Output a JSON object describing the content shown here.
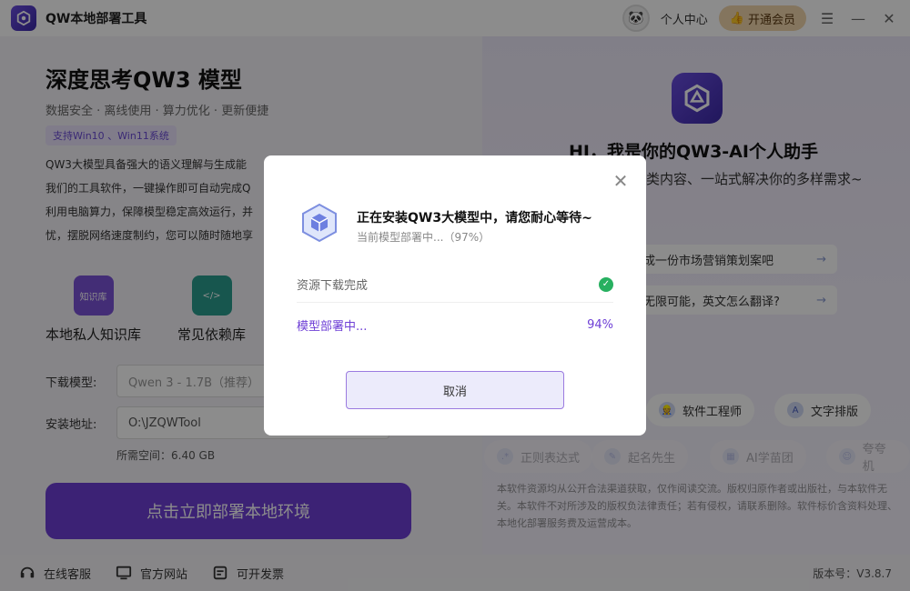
{
  "app": {
    "title": "QW本地部署工具",
    "user_center": "个人中心",
    "vip_label": "开通会员"
  },
  "left": {
    "heading": "深度思考QW3 模型",
    "subtitle": "数据安全 · 离线使用 · 算力优化 · 更新便捷",
    "tag": "支持Win10 、Win11系统",
    "desc_lines": [
      "QW3大模型具备强大的语义理解与生成能",
      "我们的工具软件，一键操作即可自动完成Q",
      "利用电脑算力，保障模型稳定高效运行，并",
      "忧，摆脱网络速度制约，您可以随时随地享"
    ],
    "features": [
      {
        "label": "本地私人知识库",
        "icon": "knowledge-base-icon",
        "icon_text": "知识库"
      },
      {
        "label": "常见依赖库",
        "icon": "code-library-icon",
        "icon_text": "</>"
      }
    ],
    "form": {
      "model_label": "下载模型:",
      "model_value": "Qwen 3 - 1.7B（推荐）",
      "path_label": "安装地址:",
      "path_value": "O:\\JZQWTool",
      "space_note": "所需空间：6.40 GB"
    },
    "deploy_btn": "点击立即部署本地环境"
  },
  "right": {
    "title": "HI，我是你的QW3-AI个人助手",
    "subtitle": "类内容、一站式解决你的多样需求~",
    "suggestions": [
      "成一份市场营销策划案吧",
      "无限可能，英文怎么翻译?"
    ],
    "chips_row1": [
      {
        "label": "软件工程师",
        "icon": "engineer-icon"
      },
      {
        "label": "文字排版",
        "icon": "text-layout-icon"
      }
    ],
    "chips_row2": [
      {
        "label": "正则表达式",
        "icon": "regex-icon"
      },
      {
        "label": "起名先生",
        "icon": "naming-icon"
      },
      {
        "label": "AI学苗团",
        "icon": "ai-team-icon"
      },
      {
        "label": "夸夸机",
        "icon": "praise-icon"
      }
    ],
    "disclaimer": "本软件资源均从公开合法渠道获取，仅作阅读交流。版权归原作者或出版社，与本软件无关。本软件不对所涉及的版权负法律责任；若有侵权，请联系删除。软件标价含资料处理、本地化部署服务费及运营成本。"
  },
  "footer": {
    "items": [
      {
        "label": "在线客服",
        "icon": "headset-icon"
      },
      {
        "label": "官方网站",
        "icon": "monitor-icon"
      },
      {
        "label": "可开发票",
        "icon": "invoice-icon"
      }
    ],
    "version": "版本号：V3.8.7"
  },
  "modal": {
    "title": "正在安装QW3大模型中，请您耐心等待~",
    "subtitle": "当前模型部署中...（97%）",
    "overall_progress": 97,
    "steps": [
      {
        "label": "资源下载完成",
        "status": "done"
      },
      {
        "label": "模型部署中...",
        "status": "in-progress",
        "progress_text": "94%",
        "progress": 94
      }
    ],
    "cancel_label": "取消"
  },
  "colors": {
    "accent": "#6e3fd6",
    "success": "#27b060",
    "vip": "#f0d6ab"
  }
}
